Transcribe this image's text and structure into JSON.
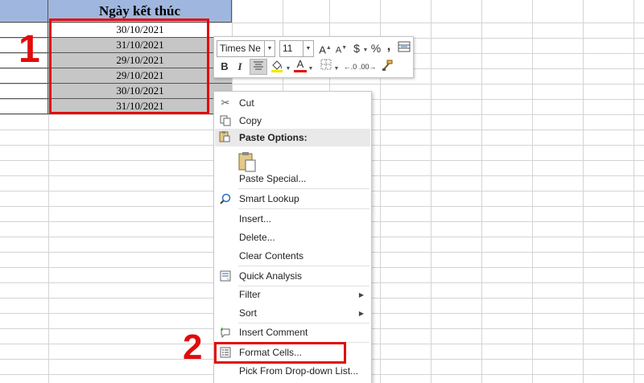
{
  "sheet": {
    "column_header": "Ngày kết thúc",
    "dates": [
      "30/10/2021",
      "31/10/2021",
      "29/10/2021",
      "29/10/2021",
      "30/10/2021",
      "31/10/2021"
    ]
  },
  "annotations": {
    "step1": "1",
    "step2": "2",
    "highlight_color": "#e10b0b"
  },
  "mini_toolbar": {
    "font_name": "Times Ne",
    "font_size": "11",
    "increase_font": "A",
    "decrease_font": "A",
    "currency": "$",
    "percent": "%",
    "comma": ",",
    "bold": "B",
    "italic": "I",
    "font_color": "A"
  },
  "context_menu": {
    "cut": "Cut",
    "copy": "Copy",
    "paste_options": "Paste Options:",
    "paste_special": "Paste Special...",
    "smart_lookup": "Smart Lookup",
    "insert": "Insert...",
    "delete": "Delete...",
    "clear_contents": "Clear Contents",
    "quick_analysis": "Quick Analysis",
    "filter": "Filter",
    "sort": "Sort",
    "insert_comment": "Insert Comment",
    "format_cells": "Format Cells...",
    "pick_from_list": "Pick From Drop-down List..."
  },
  "icons": {
    "cut": "scissors-icon",
    "copy": "copy-icon",
    "paste": "clipboard-icon",
    "smart_lookup": "search-globe-icon",
    "quick_analysis": "quick-analysis-icon",
    "insert_comment": "comment-icon",
    "format_cells": "format-cells-icon"
  }
}
